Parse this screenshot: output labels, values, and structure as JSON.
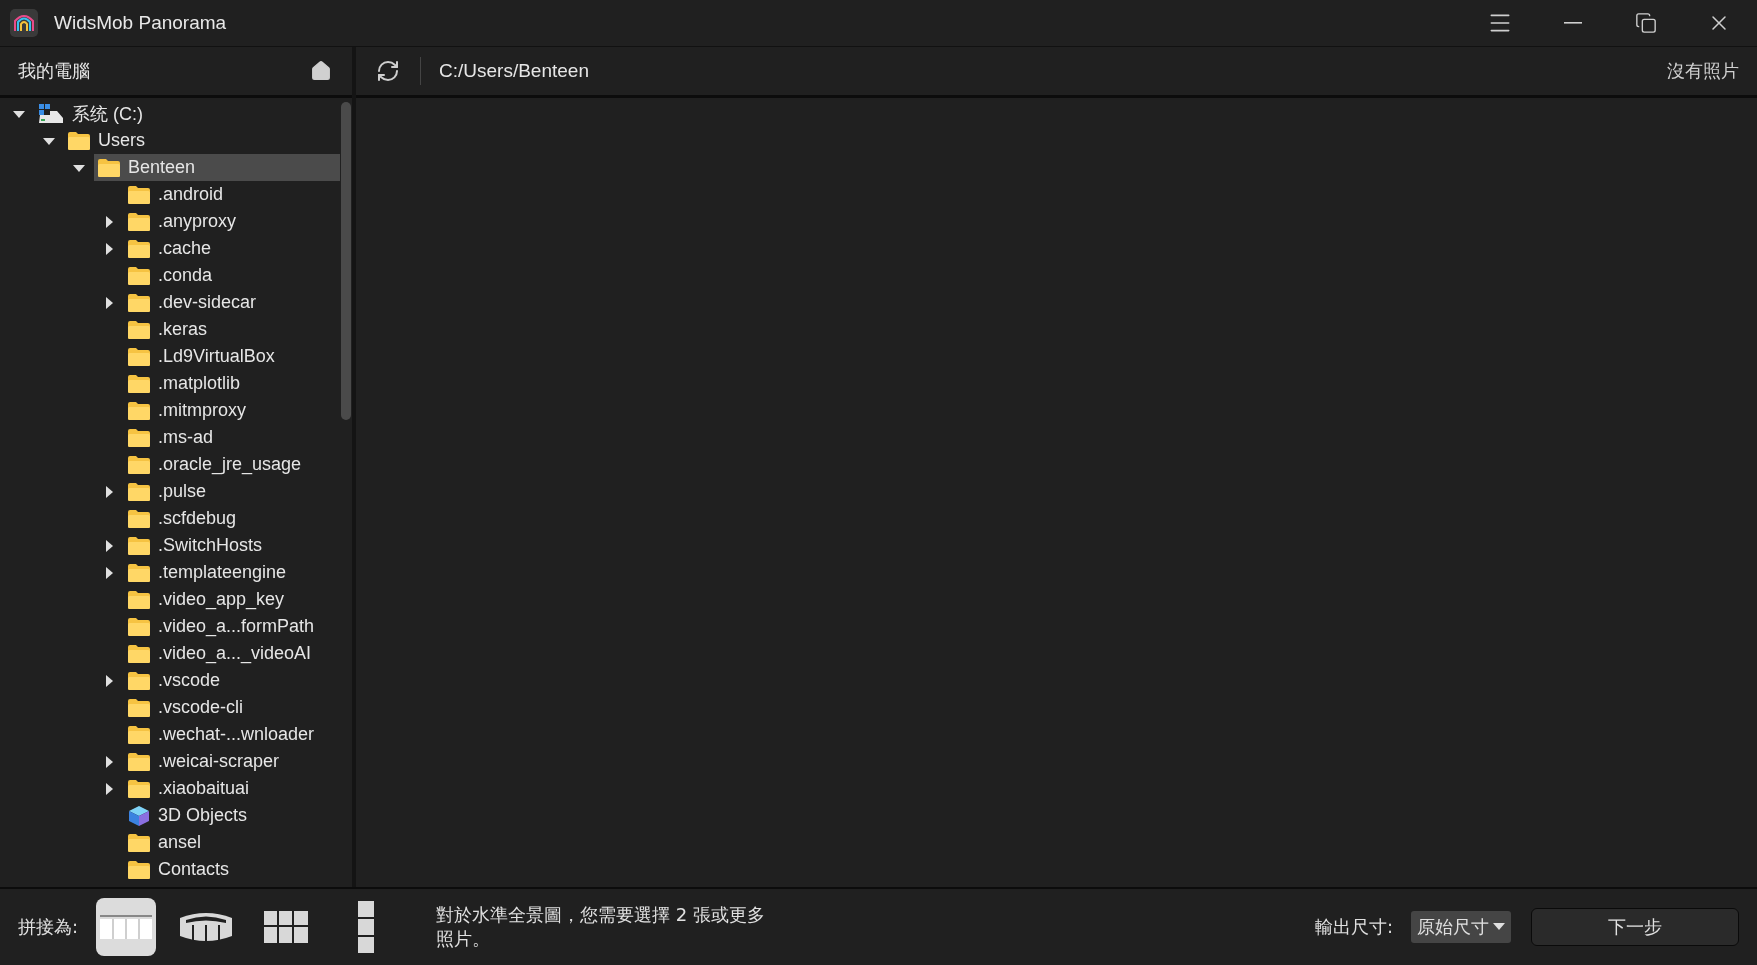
{
  "window": {
    "title": "WidsMob Panorama"
  },
  "sidebar": {
    "title": "我的電腦",
    "tree": [
      {
        "label": "系统 (C:)",
        "kind": "drive",
        "expanded": true,
        "selected": false,
        "children": [
          {
            "label": "Users",
            "kind": "folder",
            "expanded": true,
            "selected": false,
            "children": [
              {
                "label": "Benteen",
                "kind": "folder",
                "expanded": true,
                "selected": true,
                "children": [
                  {
                    "label": ".android",
                    "kind": "folder",
                    "selected": false
                  },
                  {
                    "label": ".anyproxy",
                    "kind": "folder",
                    "expanded": false,
                    "selected": false
                  },
                  {
                    "label": ".cache",
                    "kind": "folder",
                    "expanded": false,
                    "selected": false
                  },
                  {
                    "label": ".conda",
                    "kind": "folder",
                    "selected": false
                  },
                  {
                    "label": ".dev-sidecar",
                    "kind": "folder",
                    "expanded": false,
                    "selected": false
                  },
                  {
                    "label": ".keras",
                    "kind": "folder",
                    "selected": false
                  },
                  {
                    "label": ".Ld9VirtualBox",
                    "kind": "folder",
                    "selected": false
                  },
                  {
                    "label": ".matplotlib",
                    "kind": "folder",
                    "selected": false
                  },
                  {
                    "label": ".mitmproxy",
                    "kind": "folder",
                    "selected": false
                  },
                  {
                    "label": ".ms-ad",
                    "kind": "folder",
                    "selected": false
                  },
                  {
                    "label": ".oracle_jre_usage",
                    "kind": "folder",
                    "selected": false
                  },
                  {
                    "label": ".pulse",
                    "kind": "folder",
                    "expanded": false,
                    "selected": false
                  },
                  {
                    "label": ".scfdebug",
                    "kind": "folder",
                    "selected": false
                  },
                  {
                    "label": ".SwitchHosts",
                    "kind": "folder",
                    "expanded": false,
                    "selected": false
                  },
                  {
                    "label": ".templateengine",
                    "kind": "folder",
                    "expanded": false,
                    "selected": false
                  },
                  {
                    "label": ".video_app_key",
                    "kind": "folder",
                    "selected": false
                  },
                  {
                    "label": ".video_a...formPath",
                    "kind": "folder",
                    "selected": false
                  },
                  {
                    "label": ".video_a..._videoAI",
                    "kind": "folder",
                    "selected": false
                  },
                  {
                    "label": ".vscode",
                    "kind": "folder",
                    "expanded": false,
                    "selected": false
                  },
                  {
                    "label": ".vscode-cli",
                    "kind": "folder",
                    "selected": false
                  },
                  {
                    "label": ".wechat-...wnloader",
                    "kind": "folder",
                    "selected": false
                  },
                  {
                    "label": ".weicai-scraper",
                    "kind": "folder",
                    "expanded": false,
                    "selected": false
                  },
                  {
                    "label": ".xiaobaituai",
                    "kind": "folder",
                    "expanded": false,
                    "selected": false
                  },
                  {
                    "label": "3D Objects",
                    "kind": "objects",
                    "selected": false
                  },
                  {
                    "label": "ansel",
                    "kind": "folder",
                    "selected": false
                  },
                  {
                    "label": "Contacts",
                    "kind": "folder",
                    "selected": false
                  }
                ]
              }
            ]
          }
        ]
      }
    ]
  },
  "toolbar": {
    "path": "C:/Users/Benteen",
    "status": "沒有照片"
  },
  "bottom_bar": {
    "stitch_label": "拼接為:",
    "modes": [
      {
        "kind": "horizontal",
        "selected": true
      },
      {
        "kind": "cylinder",
        "selected": false
      },
      {
        "kind": "grid",
        "selected": false
      },
      {
        "kind": "vertical",
        "selected": false
      }
    ],
    "message": "對於水準全景圖，您需要選擇 2 張或更多照片。",
    "output_label": "輸出尺寸:",
    "output_size": "原始尺寸",
    "next_button": "下一步"
  }
}
